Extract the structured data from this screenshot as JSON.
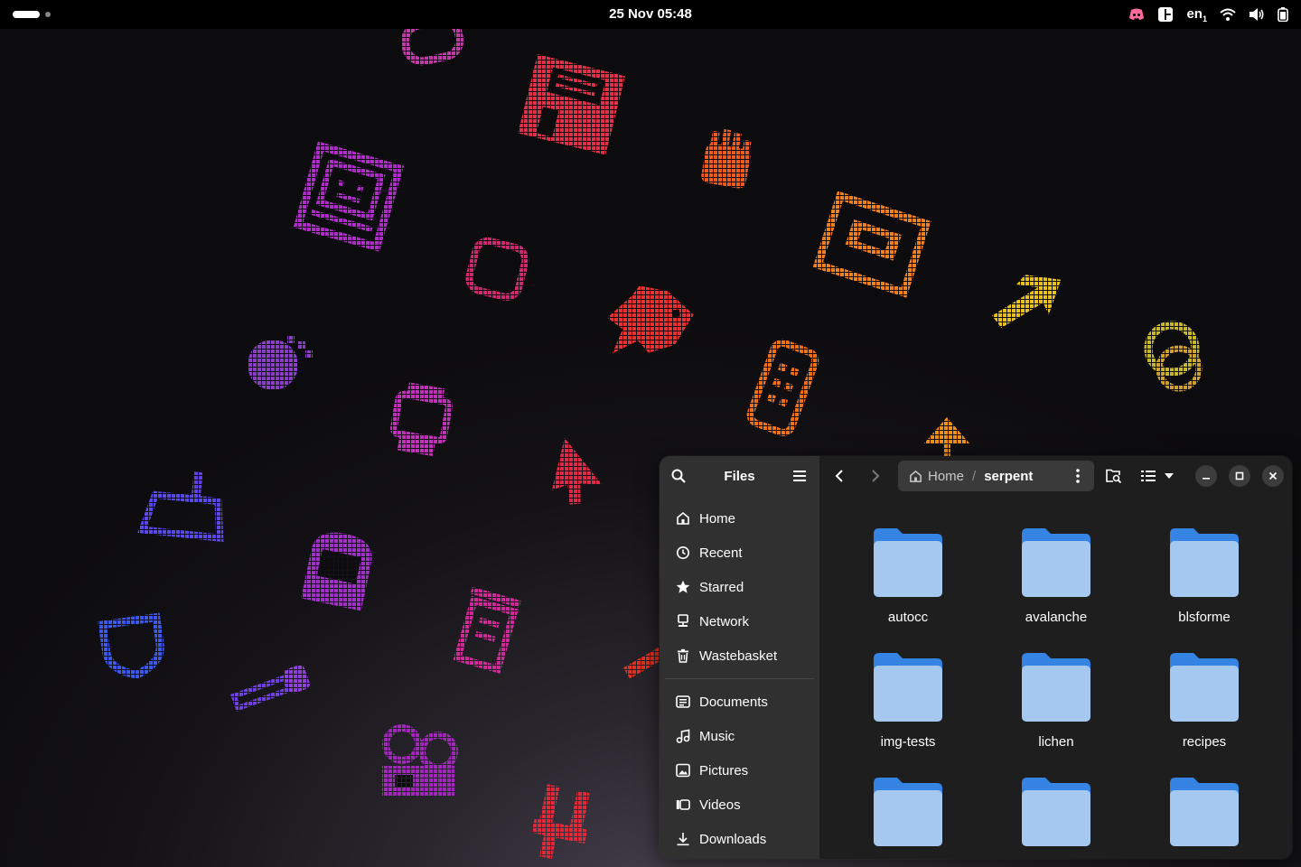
{
  "topbar": {
    "clock": "25 Nov  05:48",
    "lang": "en",
    "lang_sub": "1",
    "icons": [
      "discord-icon",
      "layout-icon",
      "wifi-icon",
      "volume-icon",
      "battery-icon"
    ]
  },
  "window": {
    "sidebar": {
      "title": "Files",
      "places": [
        {
          "label": "Home",
          "icon": "home-icon"
        },
        {
          "label": "Recent",
          "icon": "recent-icon"
        },
        {
          "label": "Starred",
          "icon": "star-icon"
        },
        {
          "label": "Network",
          "icon": "network-icon"
        },
        {
          "label": "Wastebasket",
          "icon": "trash-icon"
        }
      ],
      "bookmarks": [
        {
          "label": "Documents",
          "icon": "documents-icon"
        },
        {
          "label": "Music",
          "icon": "music-icon"
        },
        {
          "label": "Pictures",
          "icon": "pictures-icon"
        },
        {
          "label": "Videos",
          "icon": "videos-icon"
        },
        {
          "label": "Downloads",
          "icon": "downloads-icon"
        }
      ]
    },
    "pathbar": {
      "home": "Home",
      "separator": "/",
      "current": "serpent"
    },
    "folders": [
      {
        "name": "autocc"
      },
      {
        "name": "avalanche"
      },
      {
        "name": "blsforme"
      },
      {
        "name": "img-tests"
      },
      {
        "name": "lichen"
      },
      {
        "name": "recipes"
      },
      {
        "name": ""
      },
      {
        "name": ""
      },
      {
        "name": ""
      }
    ],
    "colors": {
      "folder_back": "#3584e4",
      "folder_front": "#a4c8f0"
    }
  }
}
